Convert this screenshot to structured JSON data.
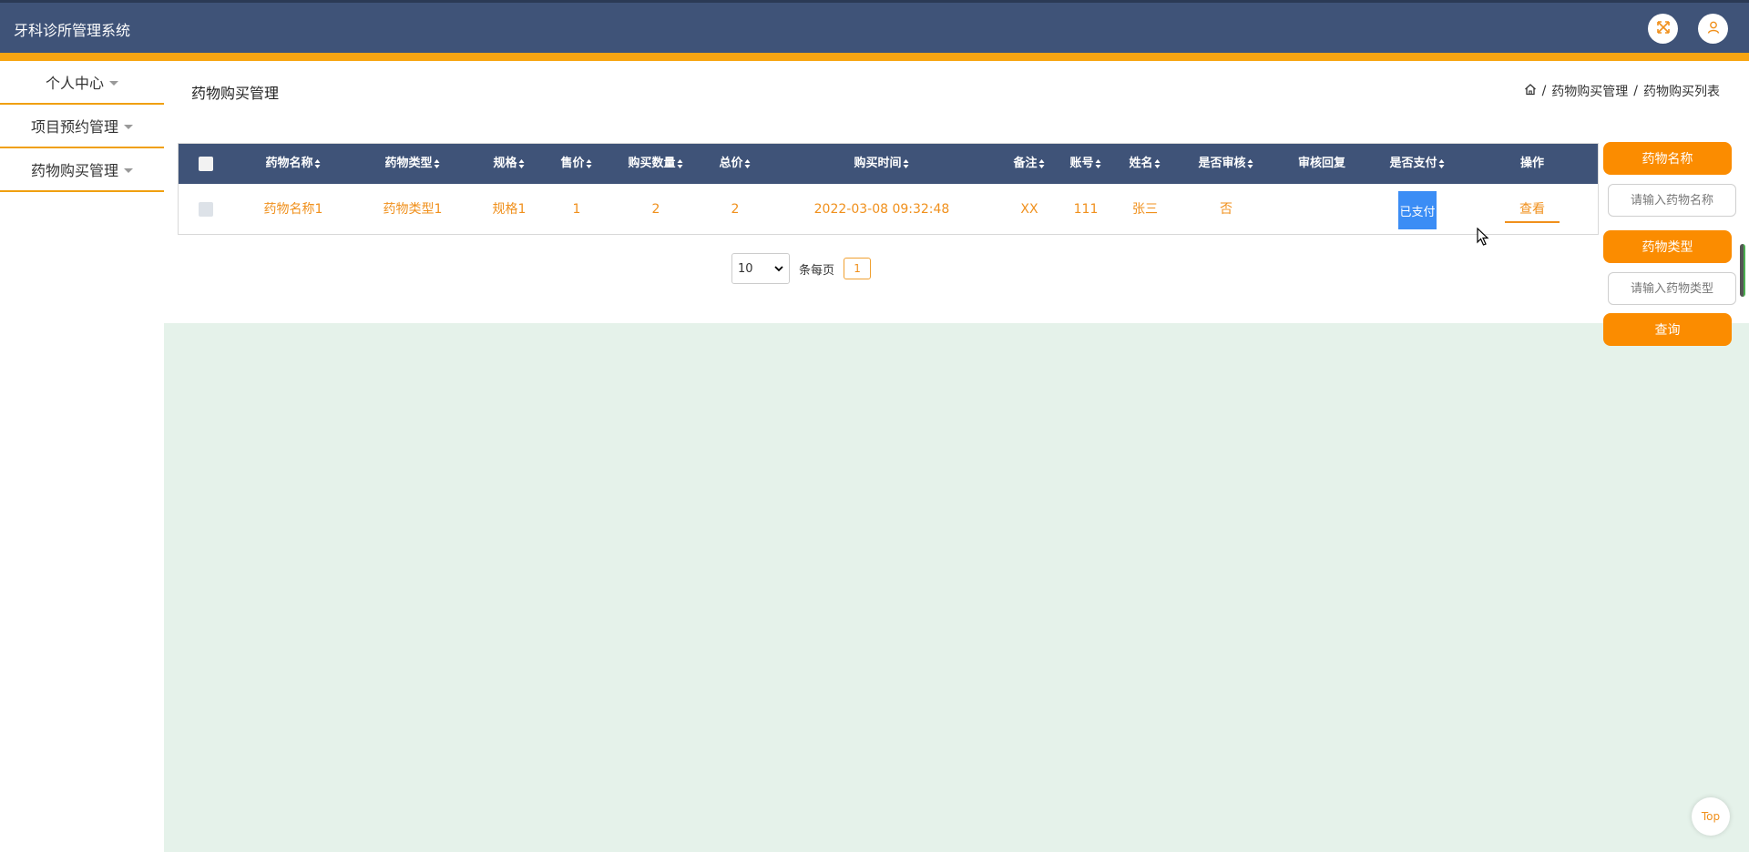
{
  "app": {
    "title": "牙科诊所管理系统"
  },
  "sidebar": {
    "items": [
      {
        "label": "个人中心"
      },
      {
        "label": "项目预约管理"
      },
      {
        "label": "药物购买管理"
      }
    ]
  },
  "page": {
    "title": "药物购买管理"
  },
  "breadcrumb": {
    "level1": "药物购买管理",
    "level2": "药物购买列表",
    "separator": "/"
  },
  "table": {
    "headers": {
      "name": "药物名称",
      "type": "药物类型",
      "spec": "规格",
      "price": "售价",
      "qty": "购买数量",
      "total": "总价",
      "time": "购买时间",
      "note": "备注",
      "account": "账号",
      "username": "姓名",
      "audit": "是否审核",
      "reply": "审核回复",
      "paid": "是否支付",
      "action": "操作"
    },
    "rows": [
      {
        "name": "药物名称1",
        "type": "药物类型1",
        "spec": "规格1",
        "price": "1",
        "qty": "2",
        "total": "2",
        "time": "2022-03-08 09:32:48",
        "note": "XX",
        "account": "111",
        "username": "张三",
        "audit": "否",
        "reply": "",
        "paid": "已支付",
        "action": "查看"
      }
    ]
  },
  "pager": {
    "page_size": "10",
    "per_page_label": "条每页",
    "current_page": "1"
  },
  "search": {
    "name_label": "药物名称",
    "name_placeholder": "请输入药物名称",
    "type_label": "药物类型",
    "type_placeholder": "请输入药物类型",
    "query_label": "查询"
  },
  "top_button": "Top",
  "colors": {
    "header": "#3f5378",
    "accent": "#fb8c00",
    "strip": "#f7a512",
    "paid": "#3b8df5",
    "lower_bg": "#e5f2ea"
  }
}
